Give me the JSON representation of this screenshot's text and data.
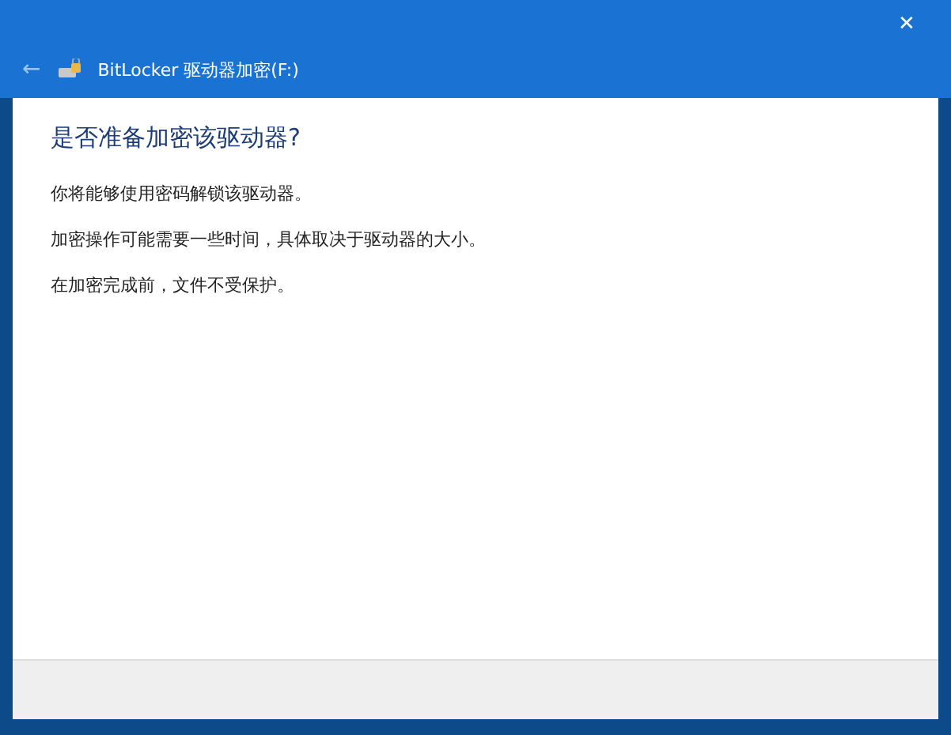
{
  "window": {
    "close": "✕",
    "back": "←",
    "title": "BitLocker 驱动器加密(F:)"
  },
  "heading": "是否准备加密该驱动器?",
  "paragraphs": [
    "你将能够使用密码解锁该驱动器。",
    "加密操作可能需要一些时间，具体取决于驱动器的大小。",
    "在加密完成前，文件不受保护。"
  ]
}
